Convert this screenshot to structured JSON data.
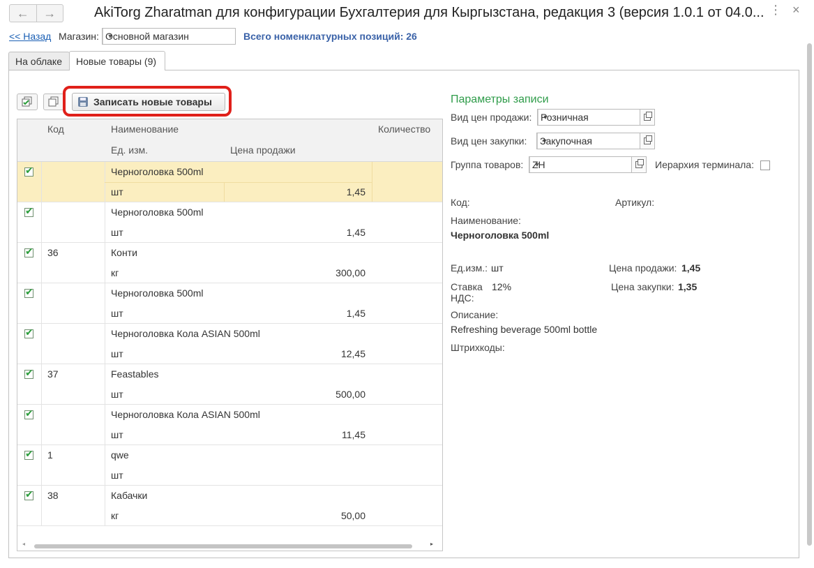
{
  "window": {
    "title": "AkiTorg Zharatman для конфигурации Бухгалтерия для Кыргызстана, редакция 3 (версия 1.0.1 от 04.0...",
    "back_icon": "←",
    "forward_icon": "→",
    "more_icon": "⋮",
    "close_icon": "×"
  },
  "toprow": {
    "back_link": "<< Назад",
    "store_label": "Магазин:",
    "store_value": "Основной магазин",
    "total_label": "Всего номенклатурных позиций: 26"
  },
  "tabs": [
    {
      "label": "На облаке"
    },
    {
      "label": "Новые товары (9)"
    }
  ],
  "toolbar": {
    "save_new_label": "Записать новые товары"
  },
  "table": {
    "headers": {
      "code": "Код",
      "name": "Наименование",
      "unit": "Ед. изм.",
      "price": "Цена продажи",
      "qty": "Количество"
    },
    "rows": [
      {
        "checked": true,
        "code": "",
        "name": "Черноголовка 500ml",
        "unit": "шт",
        "price": "1,45",
        "selected": true
      },
      {
        "checked": true,
        "code": "",
        "name": "Черноголовка 500ml",
        "unit": "шт",
        "price": "1,45"
      },
      {
        "checked": true,
        "code": "36",
        "name": "Конти",
        "unit": "кг",
        "price": "300,00"
      },
      {
        "checked": true,
        "code": "",
        "name": "Черноголовка 500ml",
        "unit": "шт",
        "price": "1,45"
      },
      {
        "checked": true,
        "code": "",
        "name": "Черноголовка Кола ASIAN 500ml",
        "unit": "шт",
        "price": "12,45"
      },
      {
        "checked": true,
        "code": "37",
        "name": "Feastables",
        "unit": "шт",
        "price": "500,00"
      },
      {
        "checked": true,
        "code": "",
        "name": "Черноголовка Кола ASIAN 500ml",
        "unit": "шт",
        "price": "11,45"
      },
      {
        "checked": true,
        "code": "1",
        "name": "qwe",
        "unit": "шт",
        "price": ""
      },
      {
        "checked": true,
        "code": "38",
        "name": "Кабачки",
        "unit": "кг",
        "price": "50,00"
      }
    ]
  },
  "params": {
    "title": "Параметры записи",
    "sale_price_type_label": "Вид цен продажи:",
    "sale_price_type_value": "Розничная",
    "purchase_price_type_label": "Вид цен закупки:",
    "purchase_price_type_value": "Закупочная",
    "group_label": "Группа товаров:",
    "group_value": "ZH",
    "hierarchy_label": "Иерархия терминала:"
  },
  "details": {
    "code_label": "Код:",
    "article_label": "Артикул:",
    "name_label": "Наименование:",
    "name_value": "Черноголовка 500ml",
    "unit_label": "Ед.изм.:",
    "unit_value": "шт",
    "sale_price_label": "Цена продажи:",
    "sale_price_value": "1,45",
    "vat_label_1": "Ставка",
    "vat_label_2": "НДС:",
    "vat_value": "12%",
    "purchase_price_label": "Цена закупки:",
    "purchase_price_value": "1,35",
    "description_label": "Описание:",
    "description_value": "Refreshing beverage 500ml bottle",
    "barcodes_label": "Штрихкоды:"
  }
}
